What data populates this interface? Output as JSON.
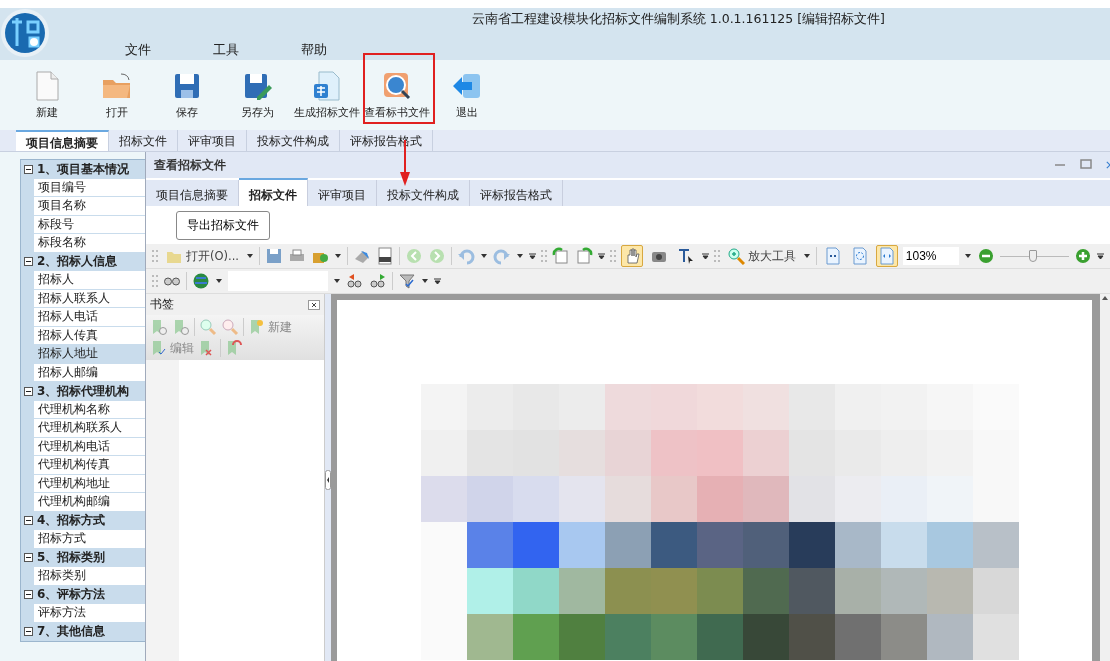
{
  "window": {
    "title": "云南省工程建设模块化招标文件编制系统 1.0.1.161125 [编辑招标文件]"
  },
  "menu": [
    "文件",
    "工具",
    "帮助"
  ],
  "toolbar": [
    {
      "label": "新建"
    },
    {
      "label": "打开"
    },
    {
      "label": "保存"
    },
    {
      "label": "另存为"
    },
    {
      "label": "生成招标文件"
    },
    {
      "label": "查看标书文件"
    },
    {
      "label": "退出"
    }
  ],
  "tabs": [
    {
      "label": "项目信息摘要",
      "selected": true
    },
    {
      "label": "招标文件",
      "selected": false
    },
    {
      "label": "评审项目",
      "selected": false
    },
    {
      "label": "投标文件构成",
      "selected": false
    },
    {
      "label": "评标报告格式",
      "selected": false
    }
  ],
  "tree": [
    {
      "label": "1、项目基本情况",
      "expanded": true,
      "children": [
        {
          "label": "项目编号",
          "selected": false
        },
        {
          "label": "项目名称",
          "selected": false
        },
        {
          "label": "标段号",
          "selected": false
        },
        {
          "label": "标段名称",
          "selected": false
        }
      ]
    },
    {
      "label": "2、招标人信息",
      "expanded": true,
      "children": [
        {
          "label": "招标人",
          "selected": false
        },
        {
          "label": "招标人联系人",
          "selected": false
        },
        {
          "label": "招标人电话",
          "selected": false
        },
        {
          "label": "招标人传真",
          "selected": false
        },
        {
          "label": "招标人地址",
          "selected": true
        },
        {
          "label": "招标人邮编",
          "selected": false
        }
      ]
    },
    {
      "label": "3、招标代理机构",
      "expanded": true,
      "children": [
        {
          "label": "代理机构名称",
          "selected": false
        },
        {
          "label": "代理机构联系人",
          "selected": false
        },
        {
          "label": "代理机构电话",
          "selected": false
        },
        {
          "label": "代理机构传真",
          "selected": false
        },
        {
          "label": "代理机构地址",
          "selected": false
        },
        {
          "label": "代理机构邮编",
          "selected": false
        }
      ]
    },
    {
      "label": "4、招标方式",
      "expanded": true,
      "children": [
        {
          "label": "招标方式",
          "selected": false
        }
      ]
    },
    {
      "label": "5、招标类别",
      "expanded": true,
      "children": [
        {
          "label": "招标类别",
          "selected": false
        }
      ]
    },
    {
      "label": "6、评标方法",
      "expanded": true,
      "children": [
        {
          "label": "评标方法",
          "selected": false
        }
      ]
    },
    {
      "label": "7、其他信息",
      "expanded": true
    }
  ],
  "viewer": {
    "title": "查看招标文件",
    "tabs": [
      {
        "label": "项目信息摘要",
        "selected": false
      },
      {
        "label": "招标文件",
        "selected": true
      },
      {
        "label": "评审项目",
        "selected": false
      },
      {
        "label": "投标文件构成",
        "selected": false
      },
      {
        "label": "评标报告格式",
        "selected": false
      }
    ],
    "export_button": "导出招标文件",
    "open_label": "打开(O)...",
    "select_tools": [
      {
        "selected": true
      },
      {
        "selected": false
      },
      {
        "selected": false
      }
    ],
    "zoom_tool_label": "放大工具",
    "view_modes": [
      {
        "selected": false
      },
      {
        "selected": false
      },
      {
        "selected": true
      }
    ],
    "zoom_value": "103%",
    "zoom_slider": {
      "level": 0.48
    },
    "bookmarks": {
      "title": "书签",
      "new_label": "新建",
      "edit_label": "编辑"
    }
  }
}
